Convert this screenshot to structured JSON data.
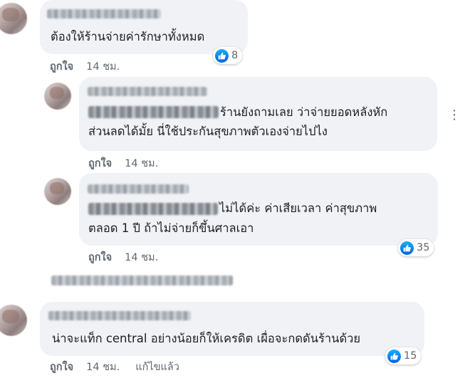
{
  "comments": [
    {
      "text_lines": [
        "ต้องให้ร้านจ่ายค่ารักษาทั้งหมด"
      ],
      "reaction_count": "8",
      "like_label": "ถูกใจ",
      "time": "14 ชม."
    },
    {
      "text_lines": [
        "ร้านยังถามเลย ว่าจ่ายยอดหลังหัก",
        "ส่วนลดได้มั้ย นี่ใช้ประกันสุขภาพตัวเองจ่ายไปไง"
      ],
      "like_label": "ถูกใจ",
      "time": "14 ชม."
    },
    {
      "text_lines": [
        "ไม่ได้ค่ะ ค่าเสียเวลา ค่าสุขภาพ",
        "ตลอด 1 ปี ถ้าไม่จ่ายก็ขึ้นศาลเอา"
      ],
      "reaction_count": "35",
      "like_label": "ถูกใจ",
      "time": "14 ชม."
    },
    {
      "text_lines": [
        "น่าจะแท็ก central อย่างน้อยก็ให้เครดิต เผื่อจะกดดันร้านด้วย"
      ],
      "reaction_count": "15",
      "like_label": "ถูกใจ",
      "time": "14 ชม.",
      "edited_label": "แก้ไขแล้ว"
    }
  ],
  "icons": {
    "reaction": "like-icon",
    "avatar": "profile-avatar"
  },
  "colors": {
    "bubble": "#f0f2f5",
    "like_blue": "#1877f2",
    "meta": "#606770"
  }
}
